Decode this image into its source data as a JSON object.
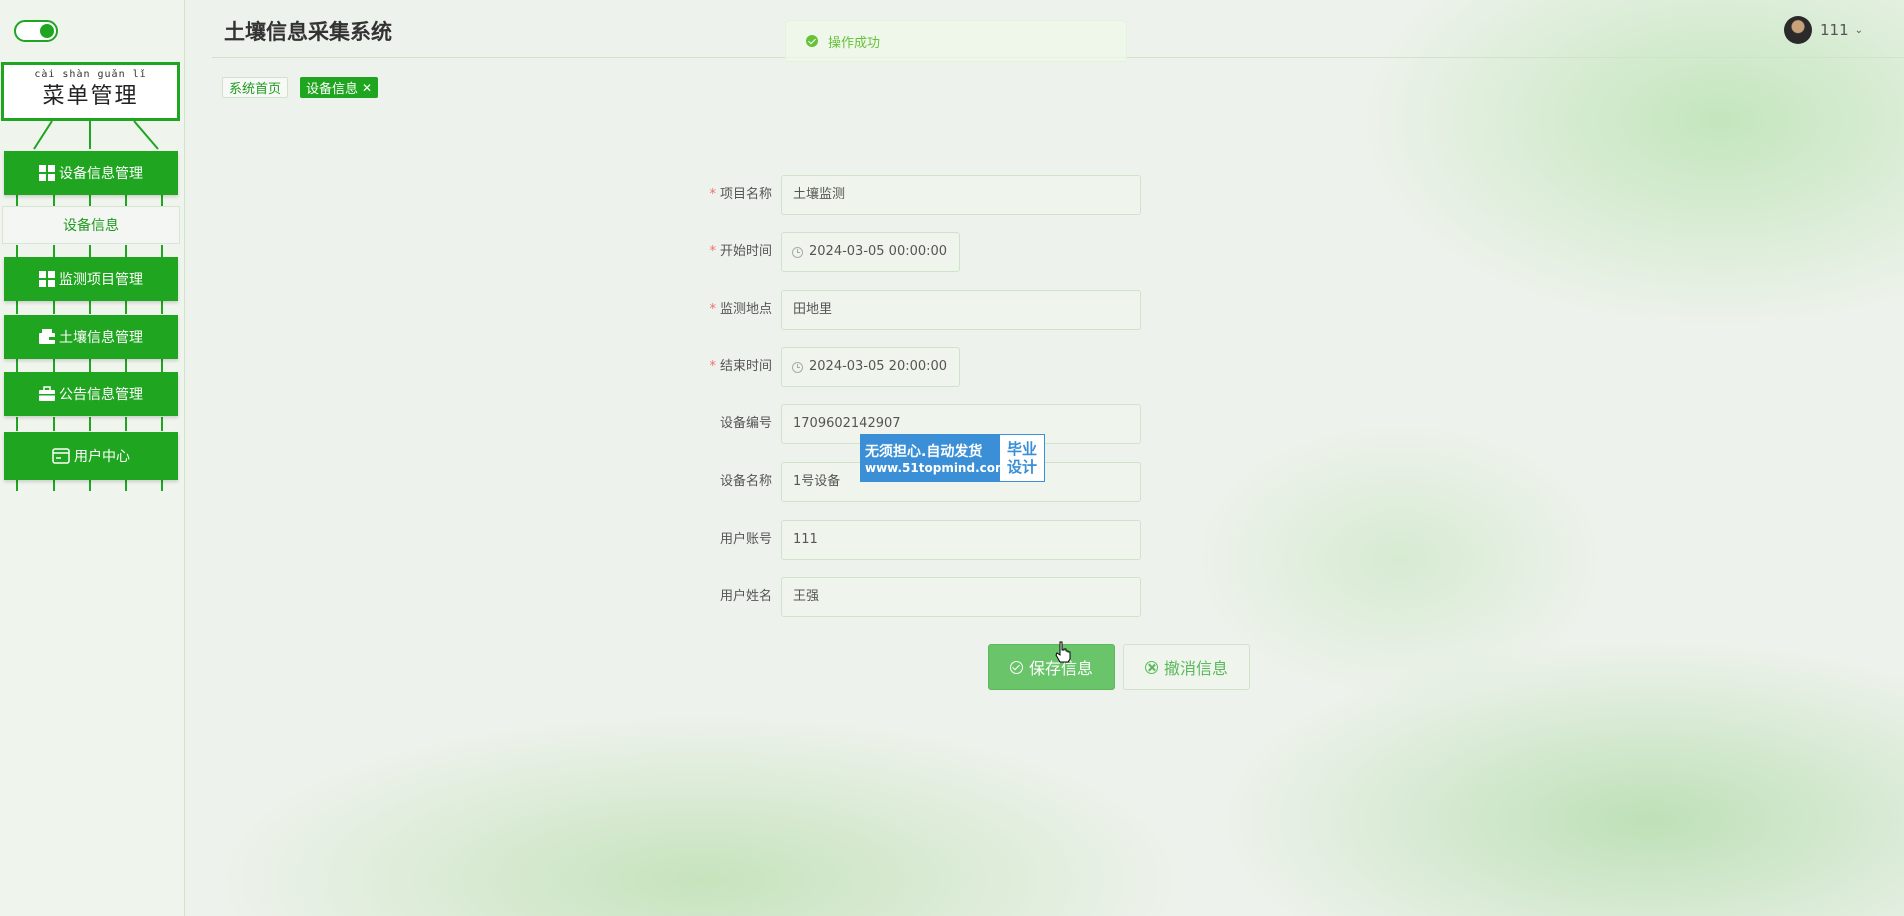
{
  "app": {
    "title": "土壤信息采集系统"
  },
  "toast": {
    "message": "操作成功",
    "type": "success"
  },
  "user": {
    "name": "111"
  },
  "sidebar": {
    "menu_sign_pinyin": "cài shàn guǎn lǐ",
    "menu_sign_title": "菜单管理",
    "items": [
      {
        "label": "设备信息管理",
        "icon": "grid-icon"
      },
      {
        "label": "设备信息",
        "icon": ""
      },
      {
        "label": "监测项目管理",
        "icon": "grid-icon"
      },
      {
        "label": "土壤信息管理",
        "icon": "wallet-icon"
      },
      {
        "label": "公告信息管理",
        "icon": "briefcase-icon"
      },
      {
        "label": "用户中心",
        "icon": "card-icon"
      }
    ]
  },
  "tabs": [
    {
      "label": "系统首页"
    },
    {
      "label": "设备信息",
      "close": "✕"
    }
  ],
  "form": {
    "fields": [
      {
        "label": "项目名称",
        "required": "*",
        "value": "土壤监测"
      },
      {
        "label": "开始时间",
        "required": "*",
        "value": "2024-03-05 00:00:00"
      },
      {
        "label": "监测地点",
        "required": "*",
        "value": "田地里"
      },
      {
        "label": "结束时间",
        "required": "*",
        "value": "2024-03-05 20:00:00"
      },
      {
        "label": "设备编号",
        "value": "1709602142907"
      },
      {
        "label": "设备名称",
        "value": "1号设备"
      },
      {
        "label": "用户账号",
        "value": "111"
      },
      {
        "label": "用户姓名",
        "value": "王强"
      }
    ],
    "save_label": "保存信息",
    "cancel_label": "撤消信息"
  },
  "ad": {
    "line1": "无须担心.自动发货",
    "line2": "www.51topmind.com",
    "badge_line1": "毕业",
    "badge_line2": "设计"
  },
  "colors": {
    "primary": "#1fa51f",
    "success": "#67c23a",
    "required": "#f56c6c",
    "ad_blue": "#3a8fd6"
  }
}
